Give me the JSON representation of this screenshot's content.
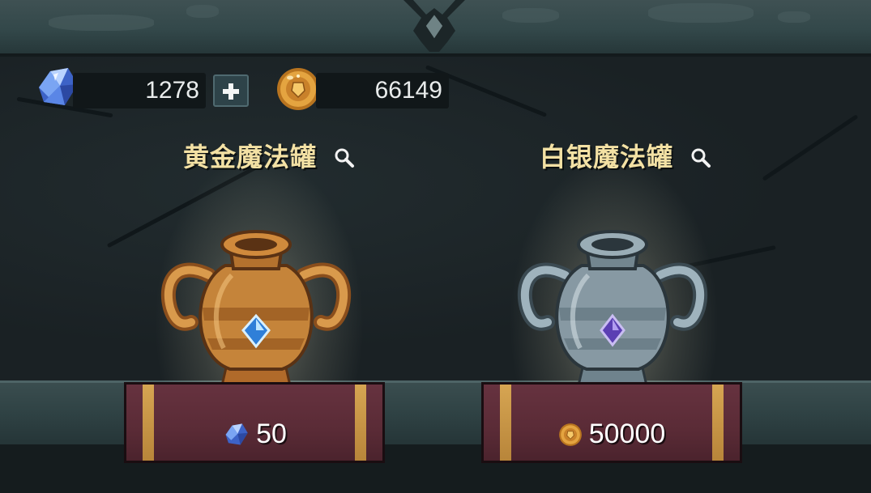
{
  "currency": {
    "gems": "1278",
    "coins": "66149",
    "gem_icon": "blue-crystal-icon",
    "coin_icon": "gold-coin-icon",
    "add_icon": "plus-icon"
  },
  "jars": [
    {
      "name": "黄金魔法罐",
      "price": "50",
      "price_icon": "blue-crystal-icon",
      "color": "#d6924a"
    },
    {
      "name": "白银魔法罐",
      "price": "50000",
      "price_icon": "gold-coin-icon",
      "color": "#8fa3ad"
    }
  ],
  "colors": {
    "title": "#f3e1a4",
    "pedestal": "#5a2b36",
    "pedestal_stripe": "#d6a552"
  }
}
